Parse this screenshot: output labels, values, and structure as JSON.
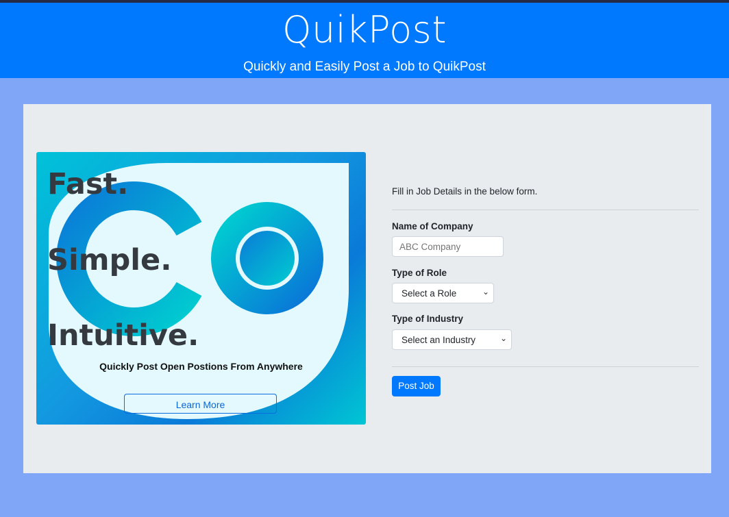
{
  "header": {
    "brand": "QuikPost",
    "tagline": "Quickly and Easily Post a Job to QuikPost"
  },
  "hero": {
    "words": [
      "Fast.",
      "Simple.",
      "Intuitive."
    ],
    "subtitle": "Quickly Post Open Postions From Anywhere",
    "learn_more": "Learn More",
    "logo_icon": "co-logo-icon"
  },
  "form": {
    "intro": "Fill in Job Details in the below form.",
    "company_label": "Name of Company",
    "company_placeholder": "ABC Company",
    "role_label": "Type of Role",
    "role_selected": "Select a Role",
    "industry_label": "Type of Industry",
    "industry_selected": "Select an Industry",
    "submit": "Post Job"
  },
  "colors": {
    "header_bg": "#0179fe",
    "page_bg": "#80a7f7",
    "panel_bg": "#e9ecef",
    "primary": "#0179fe"
  }
}
